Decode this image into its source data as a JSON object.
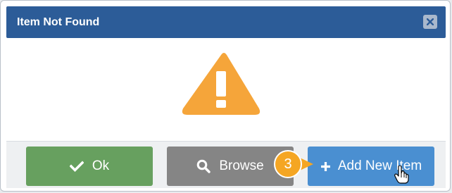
{
  "dialog": {
    "title": "Item Not Found",
    "close_icon": "close-icon",
    "body_icon": "warning-icon"
  },
  "buttons": {
    "ok": {
      "label": "Ok",
      "icon": "check-icon",
      "color": "#67a05f"
    },
    "browse": {
      "label": "Browse",
      "icon": "search-icon",
      "color": "#858585"
    },
    "add_new_item": {
      "label": "Add New Item",
      "icon": "plus-icon",
      "color": "#4a8fd1"
    }
  },
  "callout": {
    "number": "3",
    "color": "#f5a623"
  },
  "colors": {
    "titlebar": "#2c5c98",
    "warning": "#f5a53a"
  }
}
